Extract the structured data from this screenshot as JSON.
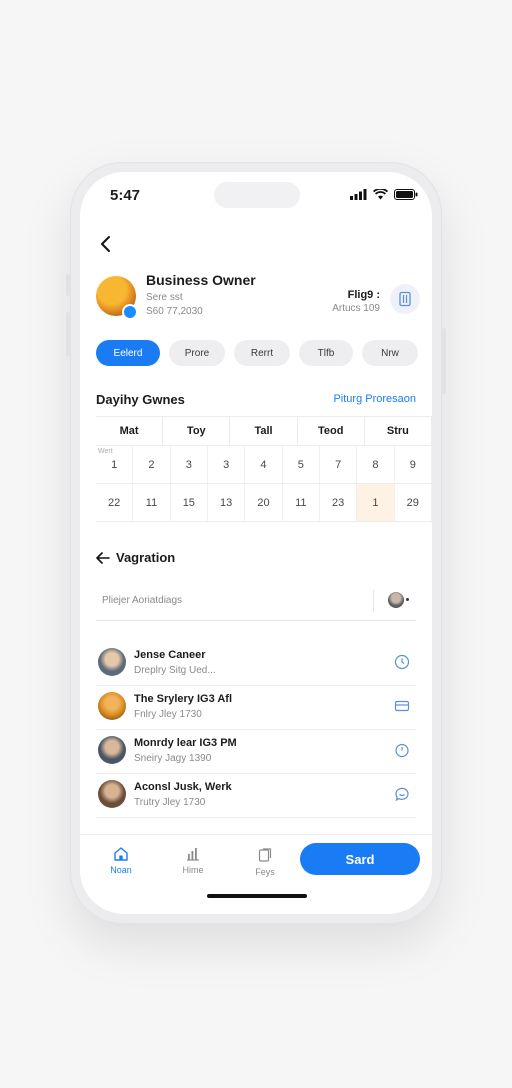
{
  "status": {
    "time": "5:47"
  },
  "profile": {
    "name": "Business Owner",
    "sub1": "Sere sst",
    "sub2": "S60 77,2030",
    "right_top": "Flig9 :",
    "right_bottom": "Artucs 109"
  },
  "chips": [
    {
      "label": "Eelerd",
      "active": true
    },
    {
      "label": "Prore",
      "active": false
    },
    {
      "label": "Rerrt",
      "active": false
    },
    {
      "label": "Tlfb",
      "active": false
    },
    {
      "label": "Nrw",
      "active": false
    }
  ],
  "schedule": {
    "title": "Dayihy Gwnes",
    "link": "Piturg Proresaon",
    "headers": [
      "Mat",
      "Toy",
      "Tall",
      "Teod",
      "Stru"
    ],
    "week_label": "Wert",
    "row1": [
      "1",
      "2",
      "3",
      "3",
      "4",
      "5",
      "7",
      "8",
      "9"
    ],
    "row2": [
      "22",
      "11",
      "15",
      "13",
      "20",
      "11",
      "23",
      "1",
      "29"
    ]
  },
  "navigation": {
    "title": "Vagration",
    "search_placeholder": "Pliejer Aoriatdiags"
  },
  "list": [
    {
      "title": "Jense Caneer",
      "subtitle": "Dreplry Sitg Ued...",
      "icon": "clock-icon",
      "avatar": "#5e6a7a"
    },
    {
      "title": "The Srylery IG3 Afl",
      "subtitle": "Fnlry Jley 1730",
      "icon": "card-icon",
      "avatar": "#d98a1e"
    },
    {
      "title": "Monrdy lear IG3 PM",
      "subtitle": "Sneiry Jagy 1390",
      "icon": "timer-icon",
      "avatar": "#4a5566"
    },
    {
      "title": "Aconsl Jusk, Werk",
      "subtitle": "Trutry Jley 1730",
      "icon": "chat-icon",
      "avatar": "#6a4e3a"
    }
  ],
  "tabs": [
    {
      "label": "Noan",
      "icon": "home-icon",
      "active": true
    },
    {
      "label": "Hime",
      "icon": "chart-icon",
      "active": false
    },
    {
      "label": "Feys",
      "icon": "doc-icon",
      "active": false
    }
  ],
  "send_label": "Sard",
  "colors": {
    "accent": "#1a7cf5",
    "highlight": "#fdf2e4"
  }
}
